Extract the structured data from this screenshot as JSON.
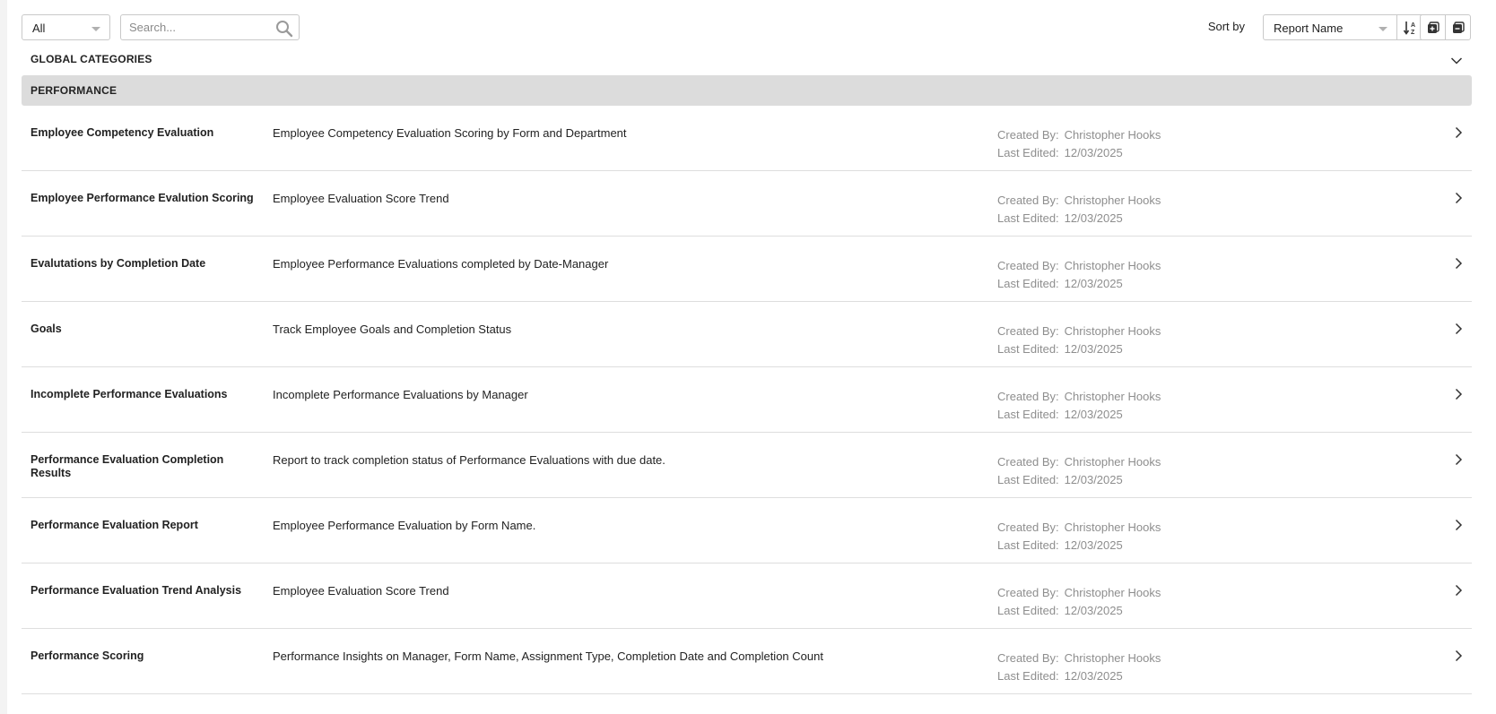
{
  "toolbar": {
    "filter_value": "All",
    "search_placeholder": "Search...",
    "sort_label": "Sort by",
    "sort_value": "Report Name"
  },
  "global_categories_label": "GLOBAL CATEGORIES",
  "category": "PERFORMANCE",
  "meta_labels": {
    "created_by": "Created By:",
    "last_edited": "Last Edited:"
  },
  "reports": [
    {
      "name": "Employee Competency Evaluation",
      "description": "Employee Competency Evaluation Scoring by Form and Department",
      "created_by": "Christopher Hooks",
      "last_edited": "12/03/2025"
    },
    {
      "name": "Employee Performance Evalution Scoring",
      "description": "Employee Evaluation Score Trend",
      "created_by": "Christopher Hooks",
      "last_edited": "12/03/2025"
    },
    {
      "name": "Evalutations by Completion Date",
      "description": "Employee Performance Evaluations completed by Date-Manager",
      "created_by": "Christopher Hooks",
      "last_edited": "12/03/2025"
    },
    {
      "name": "Goals",
      "description": "Track Employee Goals and Completion Status",
      "created_by": "Christopher Hooks",
      "last_edited": "12/03/2025"
    },
    {
      "name": "Incomplete Performance Evaluations",
      "description": "Incomplete Performance Evaluations by Manager",
      "created_by": "Christopher Hooks",
      "last_edited": "12/03/2025"
    },
    {
      "name": "Performance Evaluation Completion Results",
      "description": "Report to track completion status of Performance Evaluations with due date.",
      "created_by": "Christopher Hooks",
      "last_edited": "12/03/2025"
    },
    {
      "name": "Performance Evaluation Report",
      "description": "Employee Performance Evaluation by Form Name.",
      "created_by": "Christopher Hooks",
      "last_edited": "12/03/2025"
    },
    {
      "name": "Performance Evaluation Trend Analysis",
      "description": "Employee Evaluation Score Trend",
      "created_by": "Christopher Hooks",
      "last_edited": "12/03/2025"
    },
    {
      "name": "Performance Scoring",
      "description": "Performance Insights on Manager, Form Name, Assignment Type, Completion Date and Completion Count",
      "created_by": "Christopher Hooks",
      "last_edited": "12/03/2025"
    }
  ],
  "icons": {
    "search": "search-icon",
    "sort_direction": "sort-ascending-icon",
    "expand_all": "expand-all-icon",
    "collapse_all": "collapse-all-icon",
    "global_toggle": "chevron-down-icon",
    "row_open": "chevron-right-icon"
  },
  "colors": {
    "category_bar": "#dcdcdc",
    "meta_text": "#8e8e8e",
    "divider": "#dedede"
  }
}
